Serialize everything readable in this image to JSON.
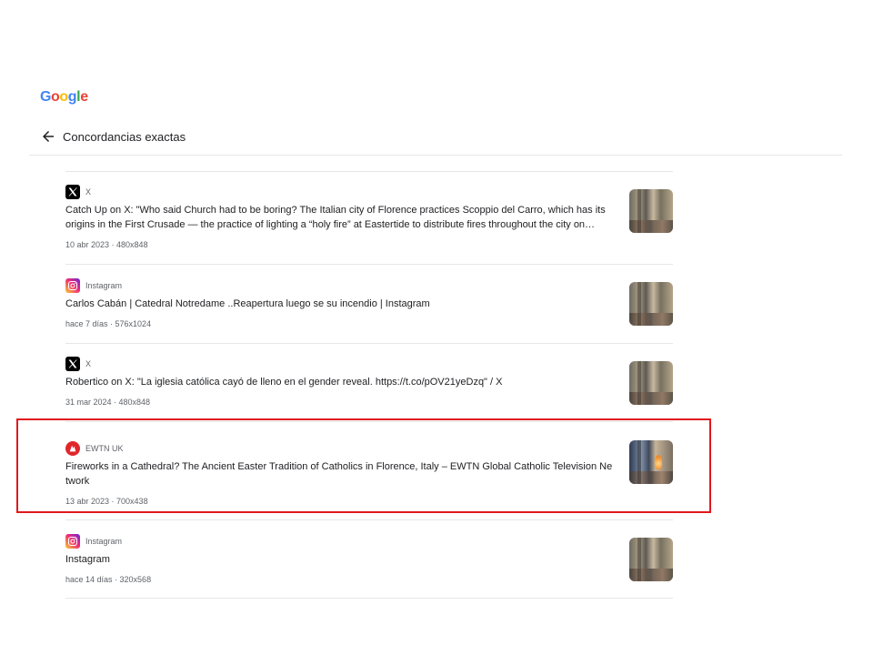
{
  "logo": {
    "letters": [
      "G",
      "o",
      "o",
      "g",
      "l",
      "e"
    ],
    "colors": [
      "#4285f4",
      "#ea4335",
      "#fbbc05",
      "#4285f4",
      "#34a853",
      "#ea4335"
    ]
  },
  "header": {
    "title": "Concordancias exactas",
    "back_icon": "arrow-left-icon"
  },
  "highlight_color": "#e0191e",
  "results": [
    {
      "source": "X",
      "icon": "x-logo-icon",
      "title": "Catch Up on X: \"Who said Church had to be boring? The Italian city of Florence practices Scoppio del Carro, which has its origins in the First Crusade — the practice of lighting a “holy fire” at Eastertide to distribute fires throughout the city on…",
      "meta": "10 abr 2023 · 480x848"
    },
    {
      "source": "Instagram",
      "icon": "instagram-icon",
      "title": "Carlos Cabán | Catedral Notredame ..Reapertura luego se su incendio | Instagram",
      "meta": "hace 7 días · 576x1024"
    },
    {
      "source": "X",
      "icon": "x-logo-icon",
      "title": "Robertico on X: \"La iglesia católica cayó de lleno en el gender reveal. https://t.co/pOV21yeDzq\" / X",
      "meta": "31 mar 2024 · 480x848"
    },
    {
      "source": "EWTN UK",
      "icon": "ewtn-icon",
      "title": "Fireworks in a Cathedral? The Ancient Easter Tradition of Catholics in Florence, Italy – EWTN Global Catholic Television Ne twork",
      "meta": "13 abr 2023 · 700x438"
    },
    {
      "source": "Instagram",
      "icon": "instagram-icon",
      "title": "Instagram",
      "meta": "hace 14 días · 320x568"
    }
  ]
}
